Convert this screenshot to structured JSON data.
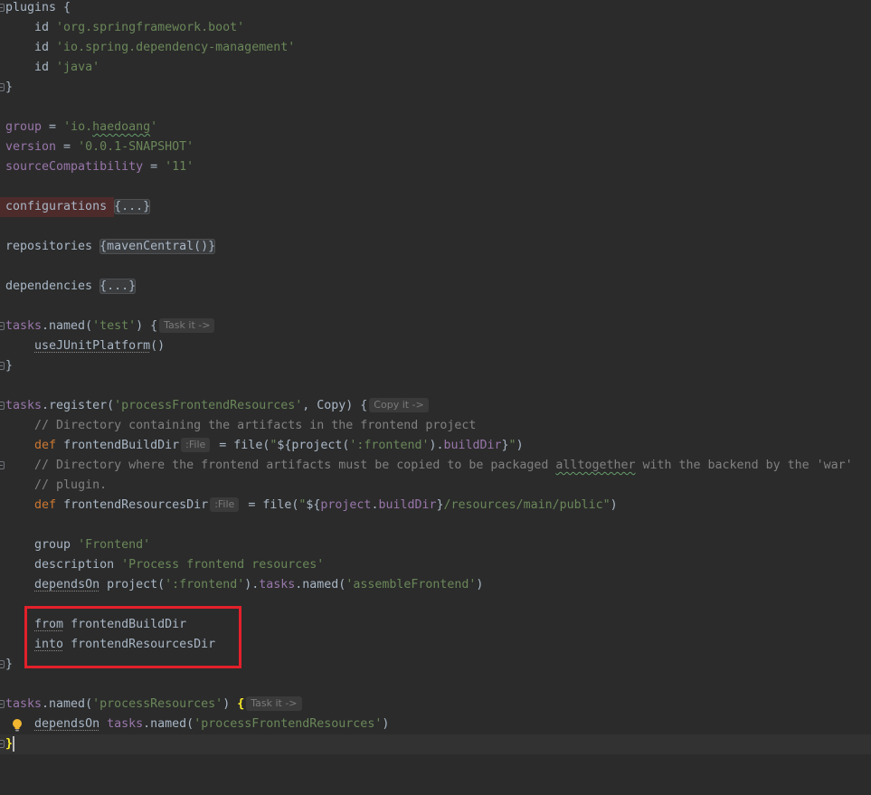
{
  "theme": {
    "background": "#2b2b2b",
    "text": "#a9b7c6",
    "string": "#6a8759",
    "comment": "#808080",
    "keyword": "#cc7832",
    "property": "#9876aa",
    "brace_match": "#ffef28",
    "hint_text": "#7a7a7a",
    "hint_bg": "#3a3a3a",
    "fold_bg": "#3a3c3e",
    "fold_border": "#4e5052",
    "current_line": "#323232",
    "error_bg": "#4e2b2b",
    "typo": "#659c6b",
    "call_underline": "#8a8a8a",
    "caret": "#bbbbbb",
    "annotation": "#e3202a",
    "lightbulb": "#f2b631",
    "gutter_marker": "#6f737a"
  },
  "icons": {
    "intention": "lightbulb-icon",
    "fold": "fold-marker-icon"
  },
  "editor": {
    "lines": [
      {
        "fold_marker": true,
        "tokens": [
          {
            "txt": "plugins {"
          }
        ]
      },
      {
        "tokens": [
          {
            "txt": "    id "
          },
          {
            "str": "'org.springframework.boot'"
          }
        ]
      },
      {
        "tokens": [
          {
            "txt": "    id "
          },
          {
            "str": "'io.spring.dependency-management'"
          }
        ]
      },
      {
        "tokens": [
          {
            "txt": "    id "
          },
          {
            "str": "'java'"
          }
        ]
      },
      {
        "fold_marker": true,
        "tokens": [
          {
            "txt": "}"
          }
        ]
      },
      {
        "tokens": []
      },
      {
        "tokens": [
          {
            "prop": "group"
          },
          {
            "txt": " = "
          },
          {
            "str": "'io."
          },
          {
            "str_typo": "haedoang"
          },
          {
            "str": "'"
          }
        ]
      },
      {
        "tokens": [
          {
            "prop": "version"
          },
          {
            "txt": " = "
          },
          {
            "str": "'0.0.1-SNAPSHOT'"
          }
        ]
      },
      {
        "tokens": [
          {
            "prop": "sourceCompatibility"
          },
          {
            "txt": " = "
          },
          {
            "str": "'11'"
          }
        ]
      },
      {
        "tokens": []
      },
      {
        "tokens": [
          {
            "err": "configurations "
          },
          {
            "fold": "{...}"
          }
        ]
      },
      {
        "tokens": []
      },
      {
        "tokens": [
          {
            "txt": "repositories "
          },
          {
            "fold": "{mavenCentral()}"
          }
        ]
      },
      {
        "tokens": []
      },
      {
        "tokens": [
          {
            "txt": "dependencies "
          },
          {
            "fold": "{...}"
          }
        ]
      },
      {
        "tokens": []
      },
      {
        "fold_marker": true,
        "tokens": [
          {
            "prop": "tasks"
          },
          {
            "txt": ".named("
          },
          {
            "str": "'test'"
          },
          {
            "txt": ") {"
          },
          {
            "hint": "Task it ->"
          }
        ]
      },
      {
        "tokens": [
          {
            "txt": "    "
          },
          {
            "call": "useJUnitPlatform"
          },
          {
            "txt": "()"
          }
        ]
      },
      {
        "fold_marker": true,
        "tokens": [
          {
            "txt": "}"
          }
        ]
      },
      {
        "tokens": []
      },
      {
        "fold_marker": true,
        "tokens": [
          {
            "prop": "tasks"
          },
          {
            "txt": ".register("
          },
          {
            "str": "'processFrontendResources'"
          },
          {
            "txt": ", Copy) {"
          },
          {
            "hint": "Copy it ->"
          }
        ]
      },
      {
        "tokens": [
          {
            "txt": "    "
          },
          {
            "cmt": "// Directory containing the artifacts in the frontend project"
          }
        ]
      },
      {
        "tokens": [
          {
            "txt": "    "
          },
          {
            "kw": "def"
          },
          {
            "txt": " frontendBuildDir"
          },
          {
            "hint": ":File"
          },
          {
            "txt": " = file("
          },
          {
            "str": "\""
          },
          {
            "txt": "${project("
          },
          {
            "str": "':frontend'"
          },
          {
            "txt": ")."
          },
          {
            "prop": "buildDir"
          },
          {
            "txt": "}"
          },
          {
            "str": "\""
          },
          {
            "txt": ")"
          }
        ]
      },
      {
        "fold_marker": true,
        "tokens": [
          {
            "txt": "    "
          },
          {
            "cmt": "// Directory where the frontend artifacts must be copied to be packaged "
          },
          {
            "cmt_typo": "alltogether"
          },
          {
            "cmt": " with the backend by the 'war'"
          }
        ]
      },
      {
        "tokens": [
          {
            "txt": "    "
          },
          {
            "cmt": "// plugin."
          }
        ]
      },
      {
        "tokens": [
          {
            "txt": "    "
          },
          {
            "kw": "def"
          },
          {
            "txt": " frontendResourcesDir"
          },
          {
            "hint": ":File"
          },
          {
            "txt": " = file("
          },
          {
            "str": "\""
          },
          {
            "txt": "${"
          },
          {
            "prop": "project"
          },
          {
            "txt": "."
          },
          {
            "prop": "buildDir"
          },
          {
            "txt": "}"
          },
          {
            "str": "/resources/main/public\""
          },
          {
            "txt": ")"
          }
        ]
      },
      {
        "tokens": []
      },
      {
        "tokens": [
          {
            "txt": "    group "
          },
          {
            "str": "'Frontend'"
          }
        ]
      },
      {
        "tokens": [
          {
            "txt": "    description "
          },
          {
            "str": "'Process frontend resources'"
          }
        ]
      },
      {
        "tokens": [
          {
            "txt": "    "
          },
          {
            "call": "dependsOn"
          },
          {
            "txt": " project("
          },
          {
            "str": "':frontend'"
          },
          {
            "txt": ")."
          },
          {
            "prop": "tasks"
          },
          {
            "txt": ".named("
          },
          {
            "str": "'assembleFrontend'"
          },
          {
            "txt": ")"
          }
        ]
      },
      {
        "tokens": []
      },
      {
        "tokens": [
          {
            "txt": "    "
          },
          {
            "call": "from"
          },
          {
            "txt": " frontendBuildDir"
          }
        ]
      },
      {
        "tokens": [
          {
            "txt": "    "
          },
          {
            "call": "into"
          },
          {
            "txt": " frontendResourcesDir"
          }
        ]
      },
      {
        "fold_marker": true,
        "tokens": [
          {
            "txt": "}"
          }
        ]
      },
      {
        "tokens": []
      },
      {
        "fold_marker": true,
        "tokens": [
          {
            "prop": "tasks"
          },
          {
            "txt": ".named("
          },
          {
            "str": "'processResources'"
          },
          {
            "txt": ") "
          },
          {
            "brace": "{"
          },
          {
            "hint": "Task it ->"
          }
        ]
      },
      {
        "intention": true,
        "tokens": [
          {
            "txt": "    "
          },
          {
            "call": "dependsOn"
          },
          {
            "txt": " "
          },
          {
            "prop": "tasks"
          },
          {
            "txt": ".named("
          },
          {
            "str": "'processFrontendResources'"
          },
          {
            "txt": ")"
          }
        ]
      },
      {
        "fold_marker": true,
        "current": true,
        "tokens": [
          {
            "brace": "}"
          }
        ]
      }
    ]
  }
}
